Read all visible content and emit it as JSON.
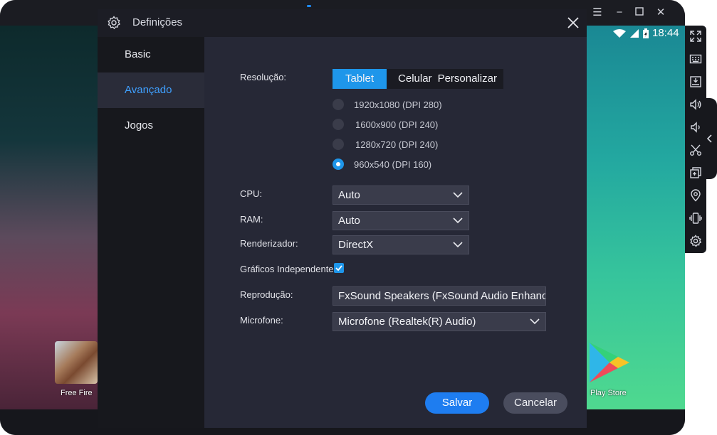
{
  "dialog": {
    "title": "Definições",
    "nav": [
      {
        "label": "Basic",
        "active": false
      },
      {
        "label": "Avançado",
        "active": true
      },
      {
        "label": "Jogos",
        "active": false
      }
    ]
  },
  "form": {
    "resolution_label": "Resolução:",
    "modes": [
      "Tablet",
      "Celular",
      "Personalizar"
    ],
    "active_mode": "Tablet",
    "resolutions": [
      {
        "label": "1920x1080 (DPI 280)",
        "selected": false
      },
      {
        "label": "1600x900 (DPI 240)",
        "selected": false
      },
      {
        "label": "1280x720 (DPI 240)",
        "selected": false
      },
      {
        "label": "960x540 (DPI 160)",
        "selected": true
      }
    ],
    "cpu_label": "CPU:",
    "cpu_value": "Auto",
    "ram_label": "RAM:",
    "ram_value": "Auto",
    "renderer_label": "Renderizador:",
    "renderer_value": "DirectX",
    "independent_graphics_label": "Gráficos Independentes",
    "independent_graphics_checked": true,
    "playback_label": "Reprodução:",
    "playback_value": "FxSound Speakers (FxSound Audio Enhancer)",
    "microphone_label": "Microfone:",
    "microphone_value": "Microfone (Realtek(R) Audio)"
  },
  "buttons": {
    "save": "Salvar",
    "cancel": "Cancelar"
  },
  "android": {
    "time": "18:44",
    "apps": [
      {
        "label": "Free Fire",
        "icon": "free-fire-icon"
      },
      {
        "label": "Play Store",
        "icon": "play-store-icon"
      }
    ]
  },
  "toolbar_icons": [
    "fullscreen-icon",
    "keyboard-icon",
    "apk-install-icon",
    "volume-up-icon",
    "volume-down-icon",
    "screenshot-cut-icon",
    "multi-instance-icon",
    "location-icon",
    "shake-icon",
    "settings-gear-icon"
  ],
  "colors": {
    "accent": "#1e96ea",
    "save": "#1e7df0",
    "active_nav": "#3fa0ff"
  }
}
